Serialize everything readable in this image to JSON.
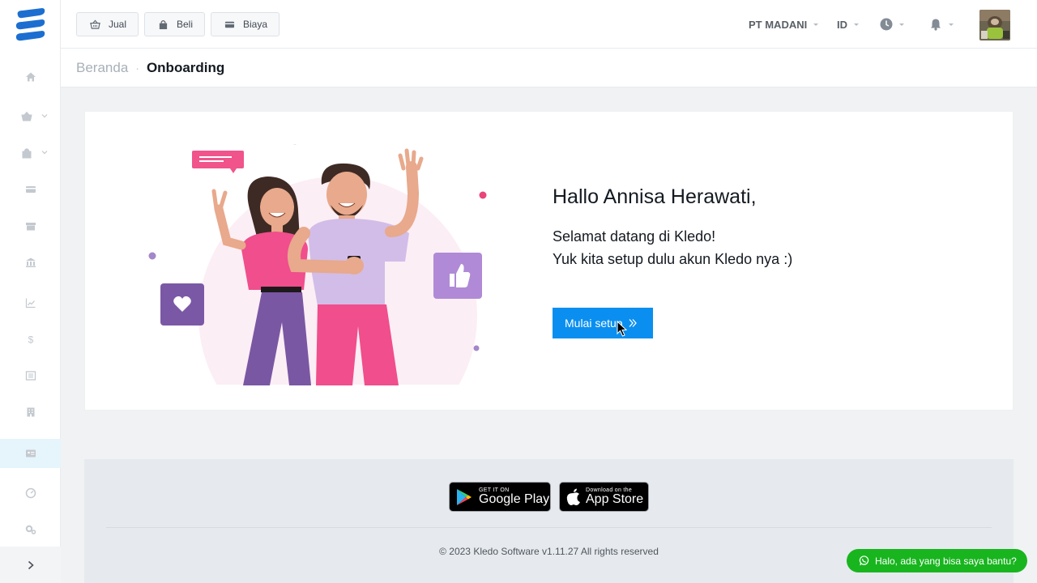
{
  "topbar": {
    "buttons": [
      {
        "label": "Jual",
        "icon": "basket-icon"
      },
      {
        "label": "Beli",
        "icon": "shopping-bag-icon"
      },
      {
        "label": "Biaya",
        "icon": "credit-card-icon"
      }
    ],
    "company": "PT MADANI",
    "language": "ID"
  },
  "sidebar": {
    "items": [
      {
        "icon": "home-icon"
      },
      {
        "icon": "basket-icon"
      },
      {
        "icon": "shopping-bag-icon"
      },
      {
        "icon": "credit-card-icon"
      },
      {
        "icon": "box-icon"
      },
      {
        "icon": "bank-icon"
      },
      {
        "icon": "chart-icon"
      },
      {
        "icon": "dollar-icon"
      },
      {
        "icon": "list-icon"
      },
      {
        "icon": "building-icon"
      },
      {
        "icon": "id-card-icon"
      },
      {
        "icon": "gauge-icon"
      },
      {
        "icon": "settings-icon"
      }
    ],
    "active_index": 10
  },
  "breadcrumb": {
    "home": "Beranda",
    "separator": "·",
    "current": "Onboarding"
  },
  "onboarding": {
    "title": "Hallo Annisa Herawati,",
    "line1": "Selamat datang di Kledo!",
    "line2": "Yuk kita setup dulu akun Kledo nya :)",
    "start_button": "Mulai setup"
  },
  "footer": {
    "google_play_small": "GET IT ON",
    "google_play_big": "Google Play",
    "app_store_small": "Download on the",
    "app_store_big": "App Store",
    "copyright": "© 2023 Kledo Software v1.11.27 All rights reserved"
  },
  "whatsapp": {
    "label": "Halo, ada yang bisa saya bantu?"
  },
  "colors": {
    "brand_blue": "#0a8ff0",
    "logo_blue": "#1c7bd8",
    "whatsapp_green": "#19b51f"
  }
}
